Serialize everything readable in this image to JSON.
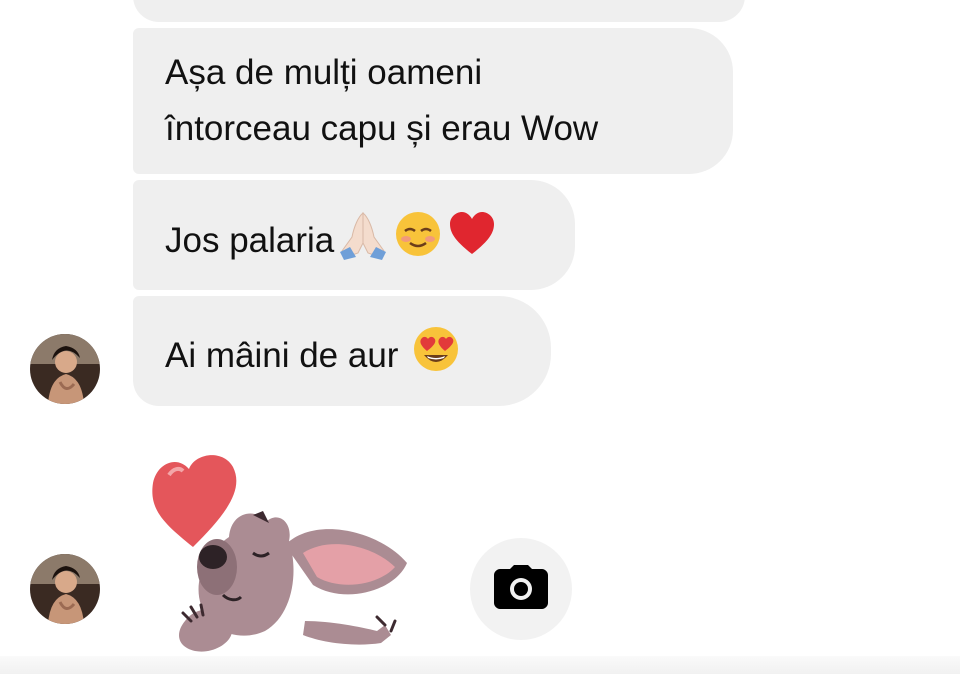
{
  "messages": [
    {
      "lines": [
        "Așa de mulți oameni",
        "întorceau capu și erau Wow"
      ]
    },
    {
      "text": "Jos palaria",
      "emojis": [
        "folded-hands-emoji",
        "smiling-face-emoji",
        "red-heart-emoji"
      ]
    },
    {
      "text": "Ai mâini de aur",
      "emojis": [
        "heart-eyes-emoji"
      ]
    }
  ],
  "sticker": {
    "name": "dog-blowing-kiss-sticker"
  },
  "camera": {
    "icon": "camera-icon"
  },
  "colors": {
    "bubble": "#efefef",
    "text": "#111111",
    "camera_bg": "#f2f2f2",
    "heart": "#e4565b",
    "dog": "#ab8c93"
  }
}
